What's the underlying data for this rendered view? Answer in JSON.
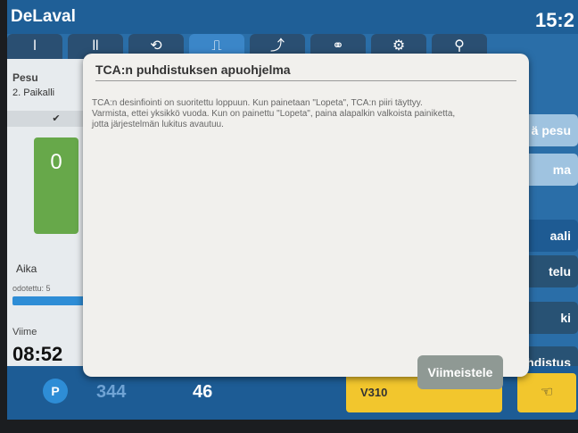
{
  "header": {
    "brand": "DeLaval",
    "clock": "15:2"
  },
  "tabs": [
    {
      "label": "Ɩ"
    },
    {
      "label": "ƖƖ"
    },
    {
      "label": "⟲"
    },
    {
      "label": "⎍"
    },
    {
      "label": "⤴"
    },
    {
      "label": "⚭"
    },
    {
      "label": "⚙"
    },
    {
      "label": "⚲"
    }
  ],
  "left_panel": {
    "title": "Pesu",
    "subtitle": "2. Paikalli",
    "check": "✔",
    "green_icon_value": "0",
    "aika_label": "Aika",
    "odotettu": "odotettu: 5",
    "viime_label": "Viime",
    "time_value": "08:52"
  },
  "right_buttons": [
    {
      "label": "ä pesu"
    },
    {
      "label": "ma"
    },
    {
      "label": "aali"
    },
    {
      "label": "telu"
    },
    {
      "label": "ki"
    },
    {
      "label": "hdistus"
    }
  ],
  "bottom": {
    "p_label": "P",
    "count1": "344",
    "count2": "46",
    "v_label": "V310",
    "hand_icon": "☜"
  },
  "dialog": {
    "title": "TCA:n puhdistuksen apuohjelma",
    "line1": "TCA:n desinfiointi on suoritettu loppuun. Kun painetaan \"Lopeta\", TCA:n piiri täyttyy.",
    "line2": "Varmista, ettei yksikkö vuoda. Kun on painettu \"Lopeta\", paina alapalkin valkoista painiketta,",
    "line3": "jotta järjestelmän lukitus avautuu.",
    "finish_button": "Viimeistele"
  }
}
